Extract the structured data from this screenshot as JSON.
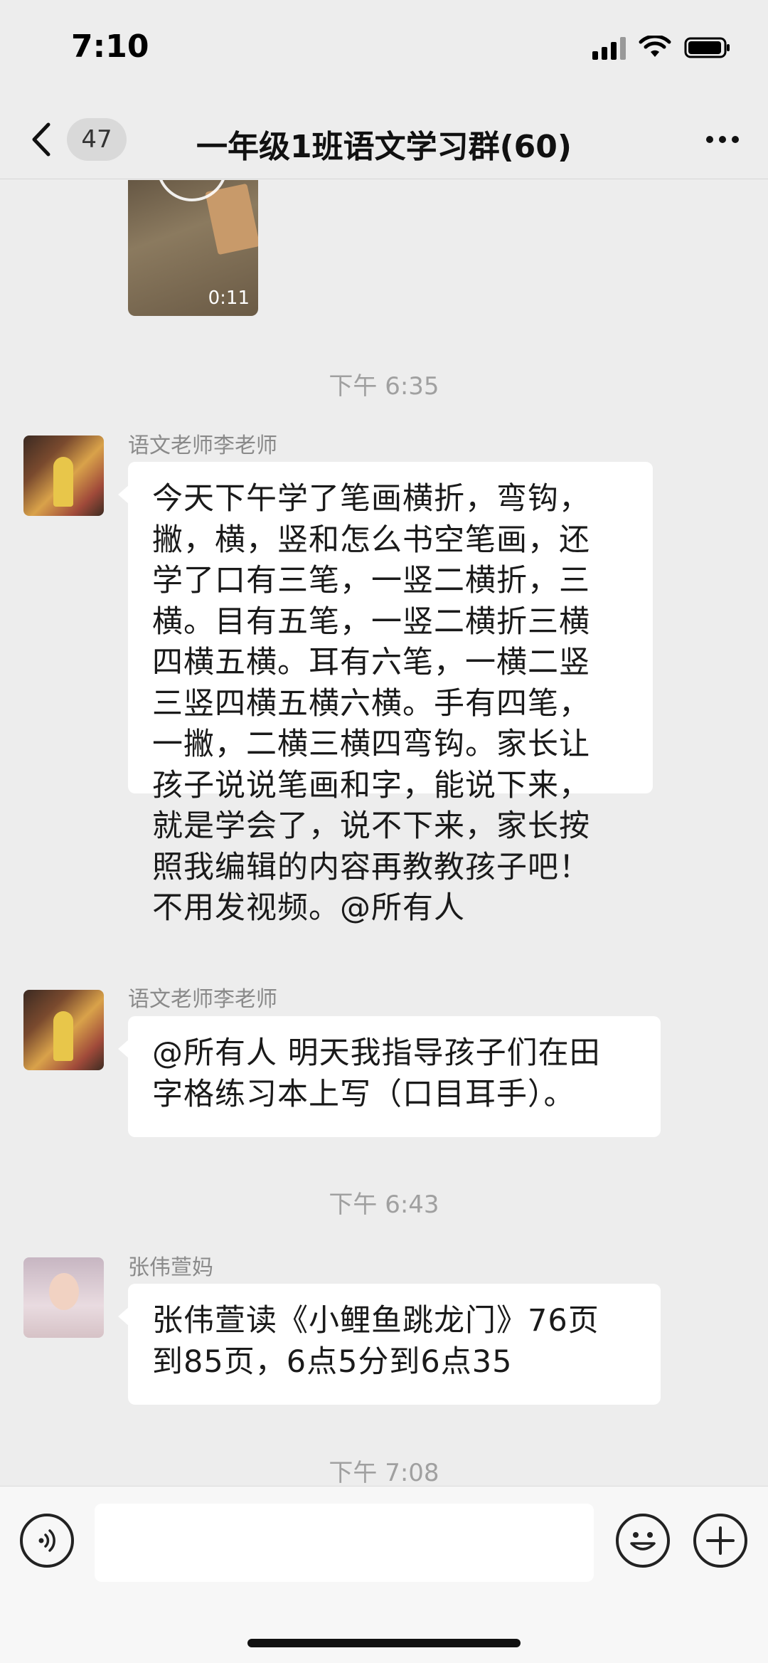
{
  "status_bar": {
    "time": "7:10"
  },
  "header": {
    "unread_count": "47",
    "title": "一年级1班语文学习群(60)"
  },
  "chat": {
    "video": {
      "duration": "0:11"
    },
    "timestamps": [
      "下午 6:35",
      "下午 6:43",
      "下午 7:08"
    ],
    "messages": [
      {
        "sender": "语文老师李老师",
        "avatar": "teacher-avatar",
        "lines": [
          "今天下午学了笔画横折，弯钩，",
          "撇，横，竖和怎么书空笔画，还",
          "学了口有三笔，一竖二横折，三",
          "横。目有五笔，一竖二横折三横",
          "四横五横。耳有六笔，一横二竖",
          "三竖四横五横六横。手有四笔，",
          "一撇，二横三横四弯钩。家长让",
          "孩子说说笔画和字，能说下来，",
          "就是学会了，说不下来，家长按",
          "照我编辑的内容再教教孩子吧！",
          "不用发视频。@所有人"
        ]
      },
      {
        "sender": "语文老师李老师",
        "avatar": "teacher-avatar",
        "lines": [
          "@所有人 明天我指导孩子们在田",
          "字格练习本上写（口目耳手）。"
        ]
      },
      {
        "sender": "张伟萱妈",
        "avatar": "mom-avatar",
        "lines": [
          "张伟萱读《小鲤鱼跳龙门》76页",
          "到85页，6点5分到6点35"
        ]
      }
    ]
  },
  "input_bar": {
    "text_value": ""
  }
}
